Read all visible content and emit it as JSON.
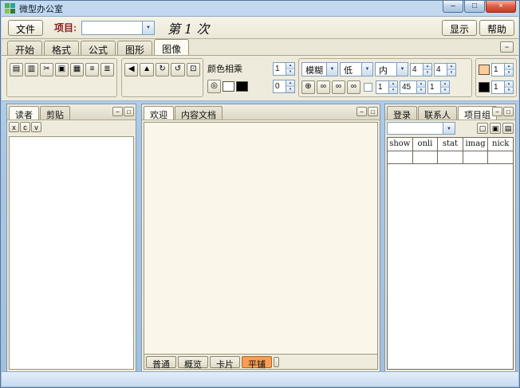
{
  "titlebar": {
    "title": "微型办公室"
  },
  "window_controls": {
    "minimize": "–",
    "maximize": "□",
    "close": "×"
  },
  "toolbar": {
    "file": "文件",
    "project_label": "项目:",
    "project_value": "",
    "doc_title": "第 1 次",
    "show": "显示",
    "help": "帮助"
  },
  "ribbon_tabs": [
    "开始",
    "格式",
    "公式",
    "图形",
    "图像"
  ],
  "ribbon": {
    "file_icons": [
      "▤",
      "▥",
      "✂",
      "▣",
      "▦",
      "≡",
      "≣"
    ],
    "transform_icons": [
      "◀",
      "▲",
      "↻",
      "↺",
      "⊡"
    ],
    "target_icon": "◎",
    "color_multiply_label": "颜色相乘",
    "multiply_value": "1",
    "offset_value": "0",
    "blur_dropdown": "模糊",
    "low_dropdown": "低",
    "inner_dropdown": "内",
    "spin_top": [
      "4",
      "4"
    ],
    "link_icons": [
      "⊕",
      "∞",
      "∞",
      "∞"
    ],
    "spin_bottom": [
      "1",
      "45",
      "1"
    ],
    "right_spin_top": "1",
    "right_spin_bottom": "1",
    "swatches": {
      "white": "#ffffff",
      "black": "#000000",
      "peach": "#ffcc99"
    }
  },
  "left_panel": {
    "tabs": [
      "读者",
      "剪贴"
    ],
    "buttons": [
      "x",
      "c",
      "v"
    ]
  },
  "center_panel": {
    "tabs": [
      "欢迎",
      "内容文档"
    ],
    "bottom_tabs": [
      "普通",
      "概览",
      "卡片",
      "平铺"
    ]
  },
  "right_panel": {
    "tabs": [
      "登录",
      "联系人",
      "项目组"
    ],
    "columns": [
      "show",
      "onli",
      "stat",
      "imag",
      "nick"
    ]
  },
  "icons": {
    "dropdown_arrow": "▼",
    "spin_up": "▴",
    "spin_down": "▾",
    "panel_minimize": "−",
    "panel_maximize": "□",
    "collapse_ribbon": "−",
    "doc_buttons": [
      "▢",
      "▣",
      "▤"
    ]
  }
}
